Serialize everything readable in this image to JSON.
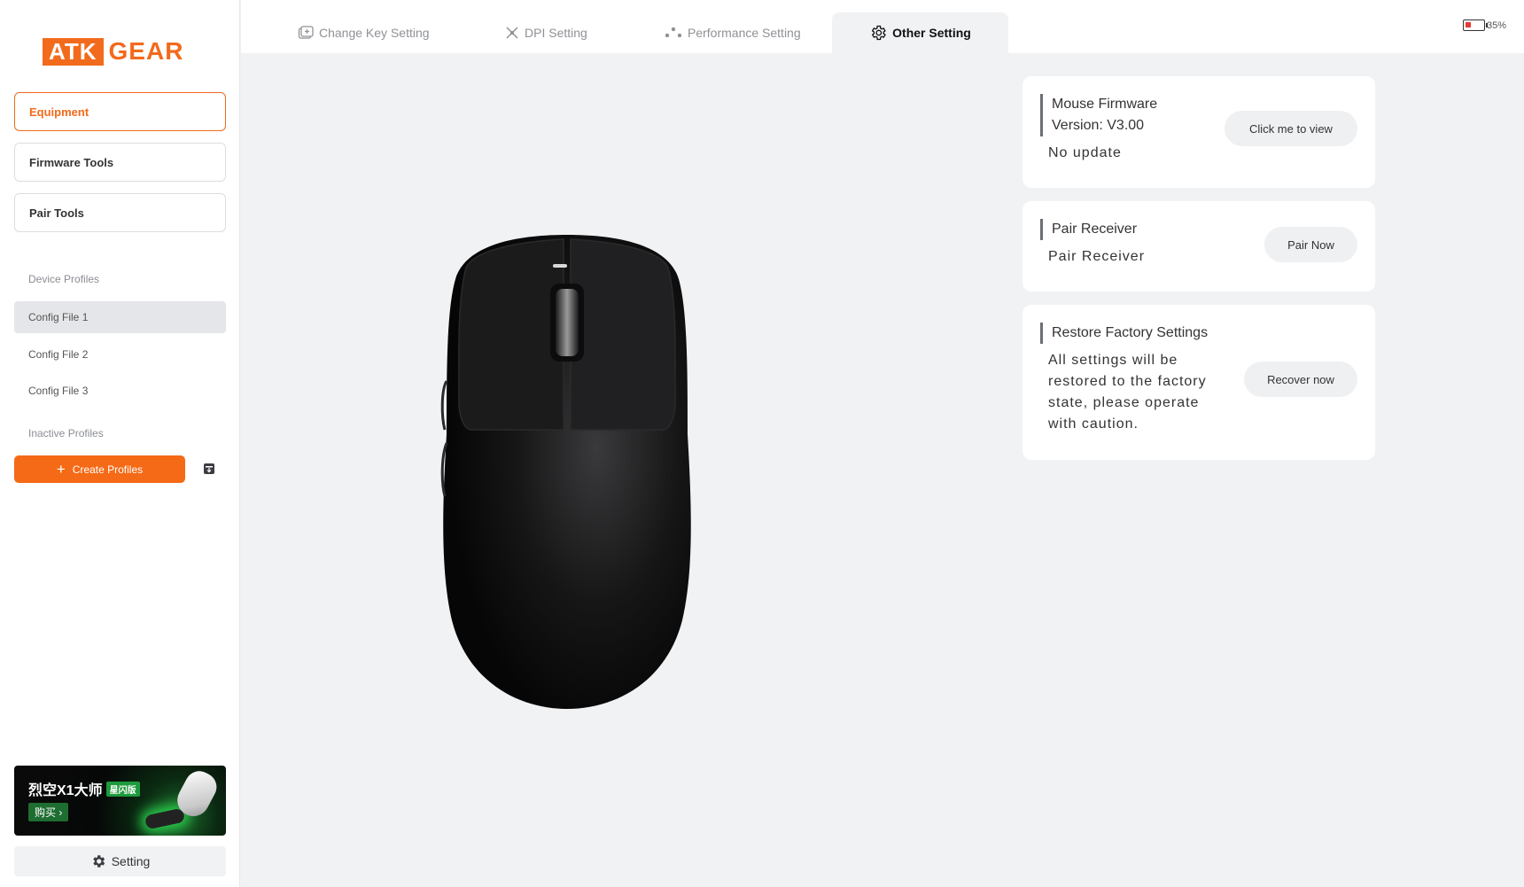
{
  "brand": {
    "logo_left": "ATK",
    "logo_right": "GEAR",
    "accent": "#f26a1b"
  },
  "sidebar": {
    "nav": [
      {
        "label": "Equipment",
        "active": true
      },
      {
        "label": "Firmware Tools",
        "active": false
      },
      {
        "label": "Pair Tools",
        "active": false
      }
    ],
    "device_profiles_label": "Device Profiles",
    "profiles": [
      {
        "label": "Config File 1",
        "selected": true
      },
      {
        "label": "Config File 2",
        "selected": false
      },
      {
        "label": "Config File 3",
        "selected": false
      }
    ],
    "inactive_profiles_label": "Inactive Profiles",
    "create_button": "Create Profiles",
    "banner": {
      "title": "烈空X1大师",
      "badge": "星闪版",
      "buy": "购买 ›"
    },
    "setting_button": "Setting"
  },
  "tabs": [
    {
      "label": "Change Key Setting",
      "icon": "key-icon",
      "active": false
    },
    {
      "label": "DPI Setting",
      "icon": "dpi-icon",
      "active": false
    },
    {
      "label": "Performance Setting",
      "icon": "performance-icon",
      "active": false
    },
    {
      "label": "Other Setting",
      "icon": "gear-icon",
      "active": true
    }
  ],
  "battery": {
    "percent_text": "35%",
    "level": 0.35,
    "color": "#e53935"
  },
  "cards": {
    "firmware": {
      "title_line1": "Mouse Firmware",
      "title_line2": "Version: V3.00",
      "status": "No update",
      "button": "Click me to view"
    },
    "pair": {
      "title": "Pair Receiver",
      "desc": "Pair Receiver",
      "button": "Pair Now"
    },
    "restore": {
      "title": "Restore Factory Settings",
      "desc_lines": [
        "All settings will be",
        "restored to the factory",
        "state, please operate",
        "with caution."
      ],
      "button": "Recover now"
    }
  }
}
